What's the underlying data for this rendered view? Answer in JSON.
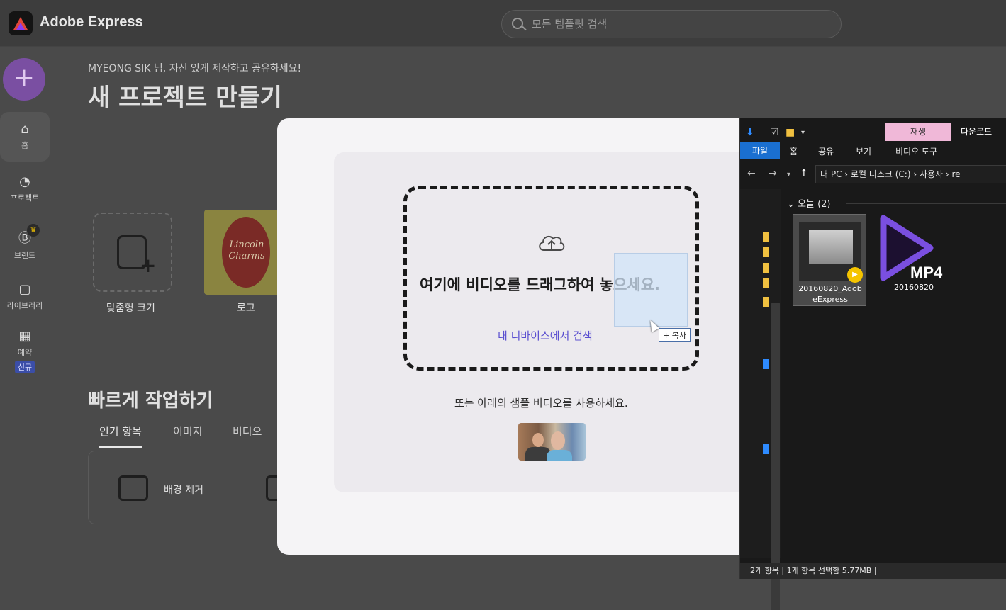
{
  "app": {
    "brand": "Adobe Express",
    "search_placeholder": "모든 템플릿 검색",
    "create_button": "+"
  },
  "nav": {
    "home": "홈",
    "projects": "프로젝트",
    "brand": "브랜드",
    "library": "라이브러리",
    "schedule": "예약",
    "new_badge": "신규"
  },
  "main": {
    "greeting": "MYEONG SIK 님, 자신 있게 제작하고 공유하세요!",
    "title": "새 프로젝트 만들기",
    "cards": [
      {
        "label": "맞춤형 크기"
      },
      {
        "label": "로고",
        "logo_text_1": "Lincoln",
        "logo_text_2": "Charms"
      }
    ],
    "quick_title": "빠르게 작업하기",
    "tabs": [
      "인기 항목",
      "이미지",
      "비디오"
    ],
    "quick_card_label": "배경 제거"
  },
  "modal": {
    "drop_text": "여기에 비디오를 드래그하여 놓으세요.",
    "browse_link": "내 디바이스에서 검색",
    "or_text": "또는 아래의 샘플 비디오를 사용하세요.",
    "copy_tooltip": "+ 복사"
  },
  "explorer": {
    "context_tab": "재생",
    "context_title": "다운로드",
    "ribbon_tabs": [
      "파일",
      "홈",
      "공유",
      "보기",
      "비디오 도구"
    ],
    "path": "내 PC  ›  로컬 디스크 (C:)  ›  사용자  ›  re",
    "group_header": "오늘 (2)",
    "files": [
      {
        "name": "20160820_AdobeExpress",
        "name_line1": "20160820_Adob",
        "name_line2": "eExpress"
      },
      {
        "name": "20160820",
        "badge": "MP4"
      }
    ],
    "status_count": "2개 항목",
    "status_selected": "1개 항목 선택함 5.77MB"
  },
  "colors": {
    "accent_link": "#5a4fd0",
    "create_button": "#7a4fa2",
    "context_tab": "#f0b8d8",
    "file_tab": "#1a6fd0",
    "play_badge": "#f5c400"
  }
}
